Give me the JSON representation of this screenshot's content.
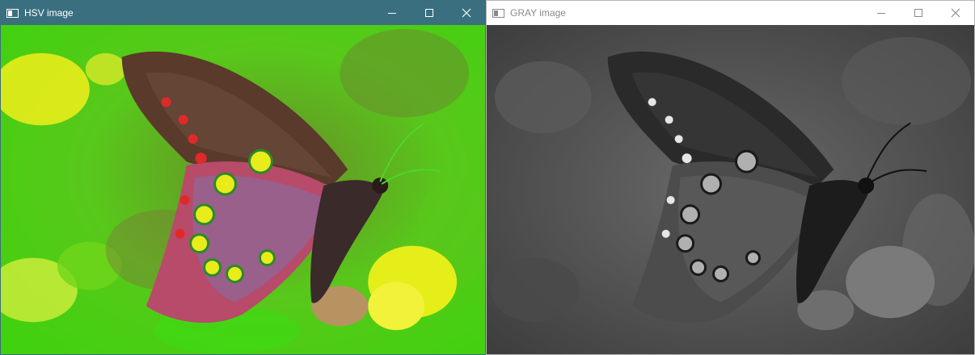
{
  "windows": [
    {
      "title": "HSV image",
      "controls": [
        "minimize",
        "maximize",
        "close"
      ]
    },
    {
      "title": "GRAY image",
      "controls": [
        "minimize",
        "maximize",
        "close"
      ]
    }
  ],
  "colors": {
    "hsv_titlebar": "#3a6f80",
    "gray_titlebar": "#ffffff",
    "hsv_background_green": "#4fd414",
    "hsv_highlight_yellow": "#e6ee1a",
    "hsv_spot_red": "#e02a2a"
  }
}
